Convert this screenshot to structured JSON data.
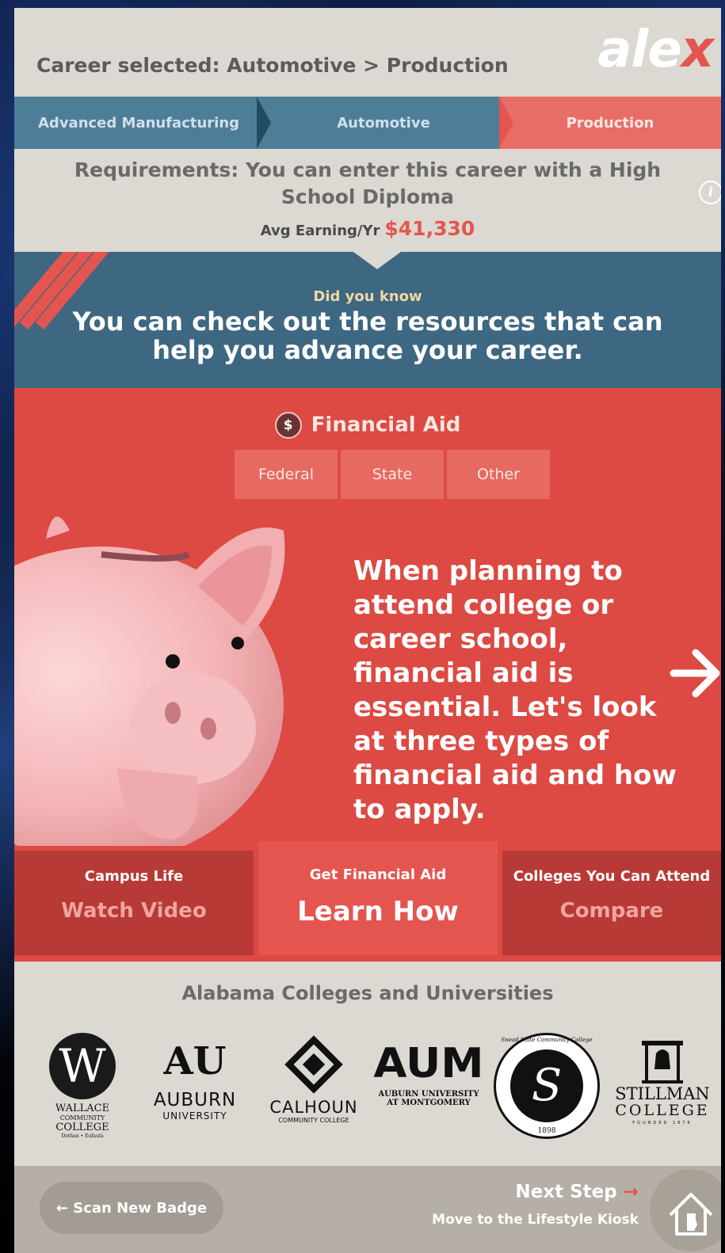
{
  "header": {
    "career_selected": "Career selected: Automotive > Production",
    "logo_text": "ale",
    "logo_x": "x"
  },
  "breadcrumb": [
    "Advanced Manufacturing",
    "Automotive",
    "Production"
  ],
  "requirements": {
    "text": "Requirements: You can enter this career with a High School Diploma",
    "earning_label": "Avg Earning/Yr",
    "earning_value": "$41,330",
    "info_glyph": "i"
  },
  "did_you_know": {
    "label": "Did you know",
    "body": "You can check out the resources that can help you advance your career."
  },
  "financial_aid": {
    "icon_glyph": "$",
    "title": "Financial Aid",
    "tabs": [
      "Federal",
      "State",
      "Other"
    ],
    "body": "When planning to attend college or career school, financial aid is essential. Let's look at three types of financial aid and how to apply."
  },
  "bottom_tabs": [
    {
      "title": "Campus Life",
      "action": "Watch Video"
    },
    {
      "title": "Get Financial Aid",
      "action": "Learn How"
    },
    {
      "title": "Colleges You Can Attend",
      "action": "Compare"
    }
  ],
  "colleges": {
    "title": "Alabama Colleges and Universities",
    "logos": {
      "wallace": {
        "mark": "W",
        "line1": "WALLACE",
        "line2": "COMMUNITY",
        "line3": "COLLEGE",
        "line4": "Dothan • Eufaula"
      },
      "auburn": {
        "mark": "AU",
        "line1": "AUBURN",
        "line2": "UNIVERSITY"
      },
      "calhoun": {
        "line1": "CALHOUN",
        "line2": "COMMUNITY COLLEGE"
      },
      "aum": {
        "mark": "AUM",
        "line1": "AUBURN UNIVERSITY",
        "line2": "AT MONTGOMERY"
      },
      "snead": {
        "mark": "S",
        "ring": "Snead State Community College",
        "year": "1898"
      },
      "stillman": {
        "line1": "STILLMAN",
        "line2": "COLLEGE",
        "line3": "FOUNDED 1876"
      }
    }
  },
  "footer": {
    "scan_button": "← Scan New Badge",
    "next_step": "Next Step",
    "next_step_arrow": "→",
    "next_step_sub": "Move to the Lifestyle Kiosk"
  },
  "icons": [
    "info-icon",
    "dollar-icon",
    "piggy-bank-icon",
    "arrow-right-icon",
    "home-icon"
  ],
  "colors": {
    "accent": "#e4554f",
    "blue": "#3e6782",
    "bg": "#dcd8d2"
  }
}
